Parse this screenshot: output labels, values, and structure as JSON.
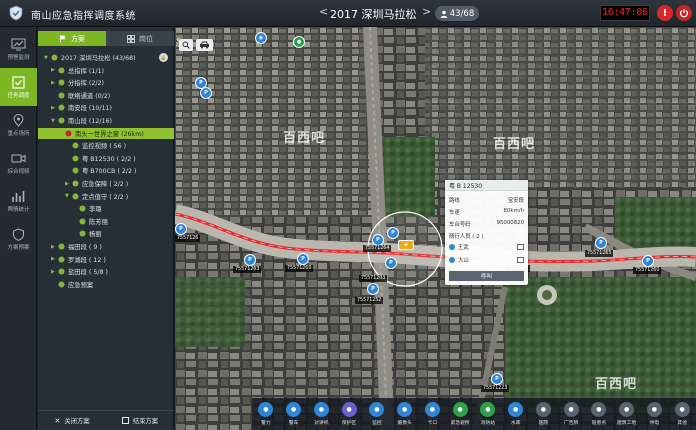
{
  "header": {
    "app_title": "南山应急指挥调度系统",
    "event_title": "2017 深圳马拉松",
    "event_prev": "<",
    "event_next": ">",
    "count": "43/68",
    "clock": "16:47:06"
  },
  "rail": [
    {
      "label": "预警监测",
      "icon": "monitor-icon"
    },
    {
      "label": "任务调度",
      "icon": "dispatch-icon"
    },
    {
      "label": "重点场所",
      "icon": "location-icon"
    },
    {
      "label": "综合视频",
      "icon": "video-icon"
    },
    {
      "label": "舆情统计",
      "icon": "stats-icon"
    },
    {
      "label": "方案预案",
      "icon": "shield-icon"
    }
  ],
  "panel": {
    "tab_plan": "方案",
    "tab_post": "岗位",
    "tree": [
      {
        "label": "2017 深圳马拉松 (43/68)",
        "level": 0,
        "tri": "open"
      },
      {
        "label": "总指挥 (1/1)",
        "level": 1,
        "tri": "closed"
      },
      {
        "label": "分指挥 (2/2)",
        "level": 1,
        "tri": "closed"
      },
      {
        "label": "联络通道 (0/2)",
        "level": 1,
        "tri": "none"
      },
      {
        "label": "南安段 (10/11)",
        "level": 1,
        "tri": "closed"
      },
      {
        "label": "南山段 (12/16)",
        "level": 1,
        "tri": "open"
      },
      {
        "label": "南头一世界之窗 (26km)",
        "level": 2,
        "tri": "none",
        "highlight": true
      },
      {
        "label": "监控视频 ( 56 )",
        "level": 3,
        "tri": "none"
      },
      {
        "label": "粤 B12530 ( 2/2 )",
        "level": 3,
        "tri": "none"
      },
      {
        "label": "粤 B700CB ( 2/2 )",
        "level": 3,
        "tri": "none"
      },
      {
        "label": "应急保障 ( 2/2 )",
        "level": 3,
        "tri": "closed"
      },
      {
        "label": "定点值守 ( 2/2 )",
        "level": 3,
        "tri": "open"
      },
      {
        "label": "李璐",
        "level": 4,
        "tri": "none"
      },
      {
        "label": "陈芳丽",
        "level": 4,
        "tri": "none"
      },
      {
        "label": "杨丽",
        "level": 4,
        "tri": "none"
      },
      {
        "label": "福田段 ( 9 )",
        "level": 1,
        "tri": "closed"
      },
      {
        "label": "罗湖段 ( 12 )",
        "level": 1,
        "tri": "closed"
      },
      {
        "label": "盐田段 ( 5/8 )",
        "level": 1,
        "tri": "closed"
      },
      {
        "label": "应急预案",
        "level": 1,
        "tri": "none"
      }
    ],
    "close_plan": "关闭方案",
    "end_plan": "结束方案"
  },
  "popup": {
    "title": "粤 B 12530",
    "rows": [
      {
        "k": "路线",
        "v": "宝安段"
      },
      {
        "k": "车速",
        "v": "80km/h"
      },
      {
        "k": "车台号码",
        "v": "95000820"
      },
      {
        "k": "随行人员 ( 2 )",
        "v": ""
      }
    ],
    "persons": [
      "王武",
      "大山"
    ],
    "call": "呼叫"
  },
  "map": {
    "watermark": "百西吧",
    "tags": [
      "7557126",
      "75571263",
      "75571260",
      "75571264",
      "75571203",
      "75571252",
      "7557123",
      "75571265",
      "75571260",
      "75571223"
    ]
  },
  "toolbar": [
    {
      "label": "警力",
      "color": "#2f86d8"
    },
    {
      "label": "警车",
      "color": "#2f86d8"
    },
    {
      "label": "对讲机",
      "color": "#2f86d8"
    },
    {
      "label": "保护区",
      "color": "#6a5fd0"
    },
    {
      "label": "监控",
      "color": "#2f86d8"
    },
    {
      "label": "摄像头",
      "color": "#2f86d8"
    },
    {
      "label": "卡口",
      "color": "#2f86d8"
    },
    {
      "label": "紧急避所",
      "color": "#2fa04a"
    },
    {
      "label": "消防站",
      "color": "#2fa04a"
    },
    {
      "label": "水库",
      "color": "#2f86d8"
    },
    {
      "label": "医院",
      "color": "#59636d"
    },
    {
      "label": "广告牌",
      "color": "#59636d"
    },
    {
      "label": "隐患点",
      "color": "#59636d"
    },
    {
      "label": "建筑工地",
      "color": "#59636d"
    },
    {
      "label": "供电",
      "color": "#59636d"
    },
    {
      "label": "其他",
      "color": "#59636d"
    }
  ]
}
